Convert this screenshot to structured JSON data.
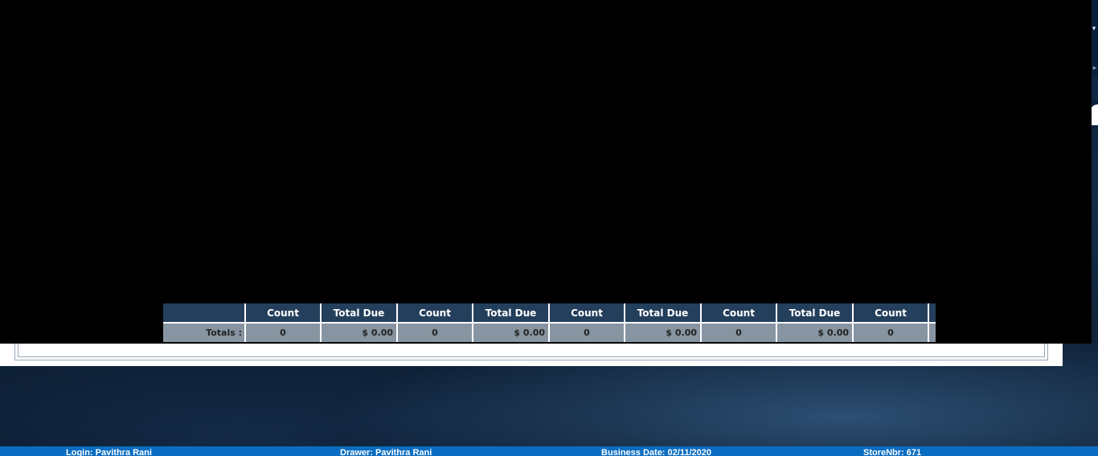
{
  "totals_table": {
    "headers": [
      "",
      "Count",
      "Total Due",
      "Count",
      "Total Due",
      "Count",
      "Total Due",
      "Count",
      "Total Due",
      "Count",
      ""
    ],
    "totals_label": "Totals :",
    "values": [
      "0",
      "$ 0.00",
      "0",
      "$ 0.00",
      "0",
      "$ 0.00",
      "0",
      "$ 0.00",
      "0",
      ""
    ]
  },
  "status_bar": {
    "login": "Login: Pavithra Rani",
    "drawer": "Drawer: Pavithra Rani",
    "business_date": "Business Date: 02/11/2020",
    "store": "StoreNbr: 671"
  },
  "icons": {
    "right_arrow": "chevron-right-icon",
    "right_caret": "caret-icon"
  },
  "colors": {
    "header_bg": "#243f5c",
    "totals_row_bg": "#8795a2",
    "status_bar_bg": "#0b6dc1"
  }
}
